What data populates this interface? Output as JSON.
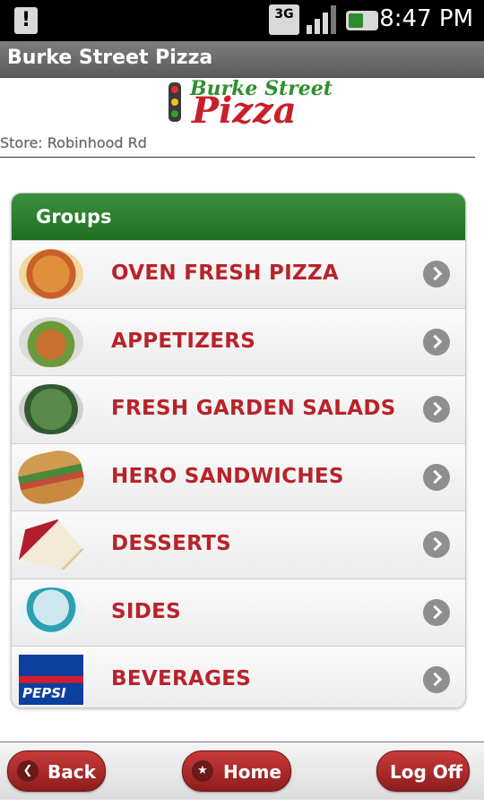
{
  "status_bar": {
    "time": "8:47 PM",
    "network": "3G"
  },
  "window_title": "Burke Street Pizza",
  "logo": {
    "line1": "Burke Street",
    "line2": "Pizza"
  },
  "store_label": "Store: Robinhood Rd",
  "groups": {
    "heading": "Groups",
    "items": [
      {
        "label": "OVEN FRESH PIZZA",
        "icon": "pizza-icon"
      },
      {
        "label": "APPETIZERS",
        "icon": "wings-icon"
      },
      {
        "label": "FRESH GARDEN SALADS",
        "icon": "salad-icon"
      },
      {
        "label": "HERO SANDWICHES",
        "icon": "sandwich-icon"
      },
      {
        "label": "DESSERTS",
        "icon": "dessert-icon"
      },
      {
        "label": "SIDES",
        "icon": "sauce-cup-icon"
      },
      {
        "label": "BEVERAGES",
        "icon": "pepsi-icon"
      }
    ]
  },
  "pepsi_text": "PEPSI",
  "nav": {
    "back": "Back",
    "home": "Home",
    "logoff": "Log Off"
  },
  "colors": {
    "accent_red": "#b8232b",
    "header_green": "#2a7d2a",
    "button_red": "#a52828"
  }
}
